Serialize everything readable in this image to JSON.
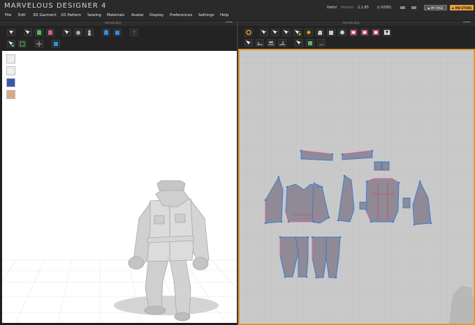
{
  "app": {
    "title": "MARVELOUS DESIGNER 4",
    "greeting": "Hello!",
    "version_label": "Version:",
    "version": "2.1.85",
    "build": "(r:0295)",
    "my_page_label": "MY PAGE",
    "md_store_label": "MD STORE"
  },
  "menu": [
    "File",
    "Edit",
    "3D Garment",
    "2D Pattern",
    "Sewing",
    "Materials",
    "Avatar",
    "Display",
    "Preferences",
    "Settings",
    "Help"
  ],
  "panels": {
    "left": {
      "title": "turnelo.Zprj"
    },
    "right": {
      "title": "turnelo.Zprj"
    }
  },
  "icons": {
    "left_toolbar_row1": [
      "arrow-down-icon",
      "select-move-icon",
      "simulate-shirt-icon",
      "shirt-edit-icon",
      "select-mesh-icon",
      "fold-icon",
      "avatar-icon",
      "garment-blue-icon",
      "garment-blue-2-icon",
      "pin-icon"
    ],
    "left_toolbar_row2": [
      "transform-icon",
      "tack-icon",
      "measure-icon",
      "texture-icon"
    ],
    "right_toolbar_row1": [
      "sync-icon",
      "transform-pattern-icon",
      "edit-point-icon",
      "edit-curve-icon",
      "add-point-icon",
      "fold-point-icon",
      "polygon-icon",
      "rectangle-icon",
      "circle-icon",
      "internal-polygon-icon",
      "internal-rectangle-icon",
      "internal-circle-icon",
      "dart-icon"
    ],
    "right_toolbar_row2": [
      "segment-sewing-icon",
      "free-sewing-icon",
      "edit-sewing-icon",
      "check-sewing-icon",
      "texture-edit-icon",
      "grain-icon",
      "fit-icon"
    ],
    "side_tools": [
      "avatar-display-icon",
      "avatar-pose-icon",
      "texture-view-icon",
      "avatar-skin-icon"
    ]
  },
  "colors": {
    "accent": "#e09a2e",
    "pattern_fill": "#8f8a95",
    "seam_blue": "#2f7bd8",
    "seam_pink": "#e85aa8",
    "grid_2d": "#b9b9b9"
  }
}
